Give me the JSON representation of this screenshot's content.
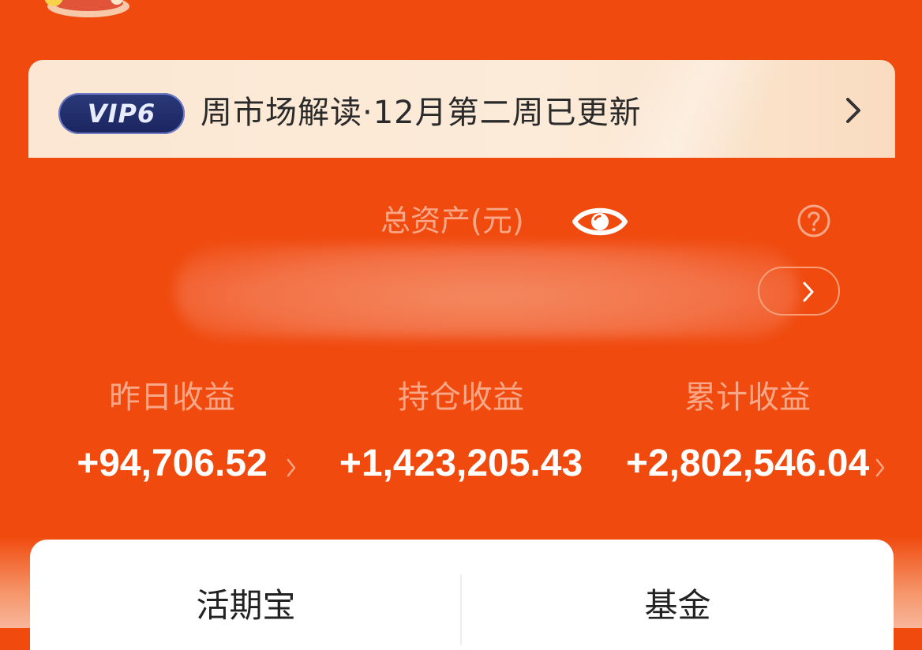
{
  "vip_banner": {
    "badge": "VIP6",
    "text": "周市场解读·12月第二周已更新"
  },
  "assets": {
    "label": "总资产(元)"
  },
  "stats": [
    {
      "label": "昨日收益",
      "value": "+94,706.52"
    },
    {
      "label": "持仓收益",
      "value": "+1,423,205.43"
    },
    {
      "label": "累计收益",
      "value": "+2,802,546.04"
    }
  ],
  "tabs": [
    {
      "label": "活期宝"
    },
    {
      "label": "基金"
    }
  ],
  "colors": {
    "background": "#F04A0E",
    "banner": "#FCEBD9",
    "vip_badge": "#1A2560",
    "label_text": "#F8A888",
    "value_text": "#FFFFFF"
  },
  "icons": [
    "eye-icon",
    "help-icon",
    "chevron-right-icon"
  ]
}
